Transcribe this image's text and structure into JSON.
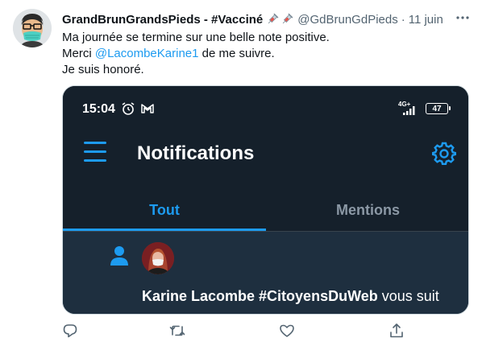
{
  "tweet": {
    "author_name": "GrandBrunGrandsPieds - #Vacciné",
    "handle": "@GdBrunGdPieds",
    "separator": "·",
    "time": "11 juin",
    "text_line1": "Ma journée se termine sur une belle note positive.",
    "text_line2_prefix": "Merci ",
    "text_mention": "@LacombeKarine1",
    "text_line2_suffix": " de me suivre.",
    "text_line3": "Je suis honoré."
  },
  "screenshot": {
    "clock": "15:04",
    "network": "4G+",
    "battery": "47",
    "app_title": "Notifications",
    "tabs": [
      {
        "label": "Tout",
        "active": true
      },
      {
        "label": "Mentions",
        "active": false
      }
    ],
    "notification": {
      "name": "Karine Lacombe #CitoyensDuWeb",
      "action": " vous suit"
    }
  },
  "colors": {
    "accent": "#1d9bf0",
    "dark_bg": "#15202b",
    "notif_bg": "#1e2f3f",
    "muted": "#536471"
  },
  "icons": [
    "more-icon",
    "syringe-icon",
    "alarm-icon",
    "gmail-icon",
    "signal-icon",
    "hamburger-icon",
    "gear-icon",
    "person-icon",
    "reply-icon",
    "retweet-icon",
    "like-icon",
    "share-icon"
  ]
}
